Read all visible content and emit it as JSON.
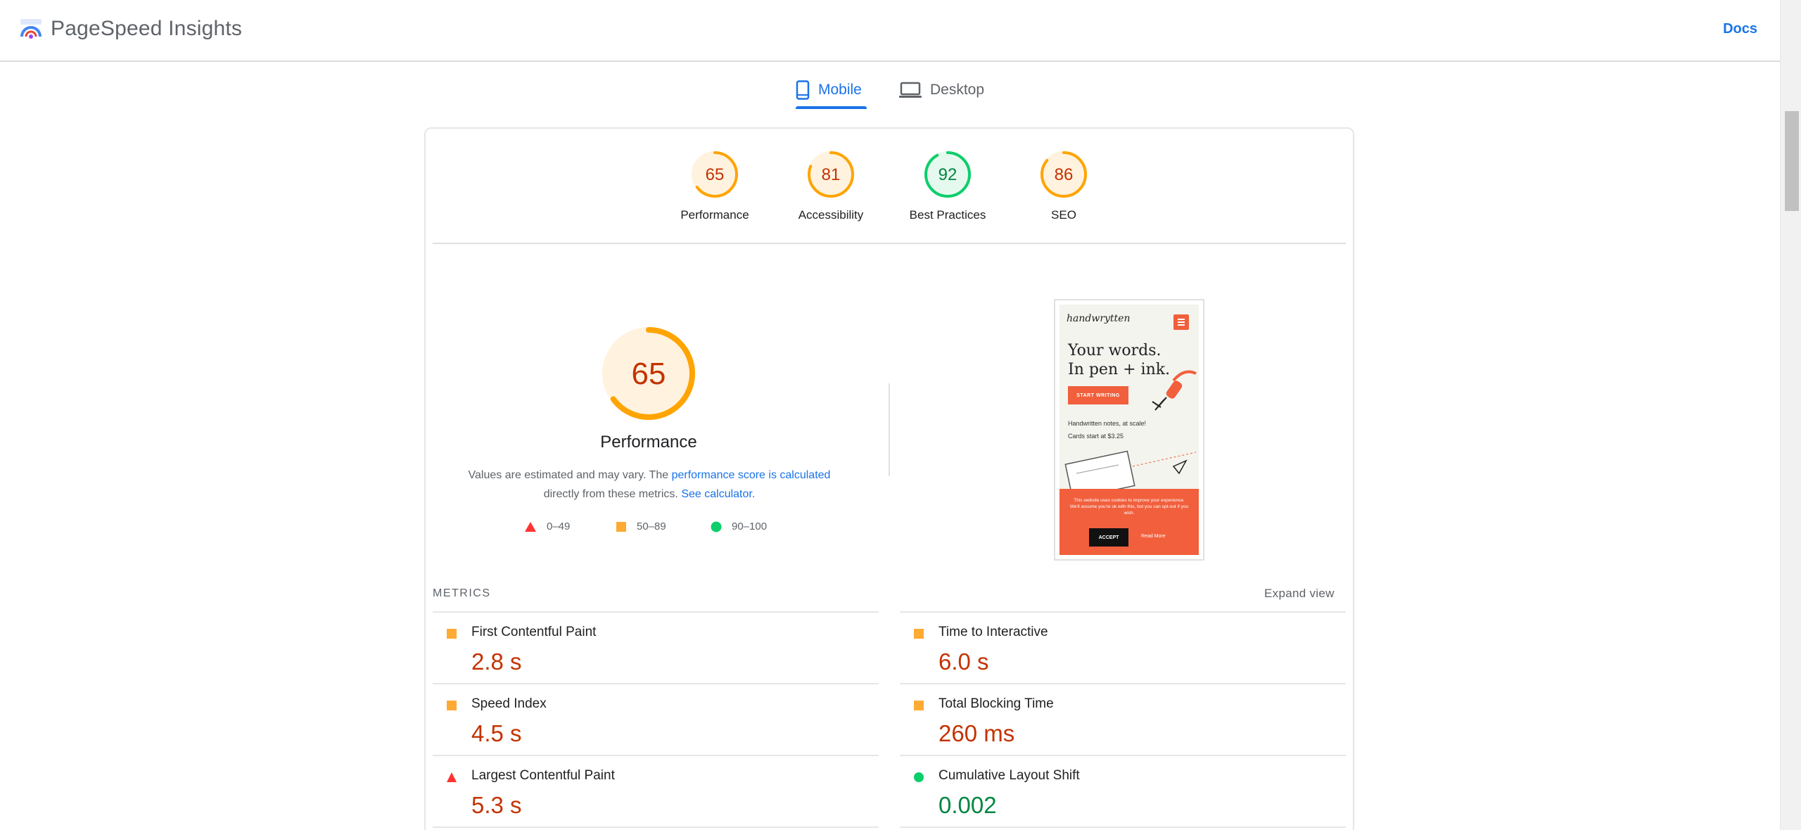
{
  "header": {
    "title": "PageSpeed Insights",
    "docs_label": "Docs"
  },
  "tabs": [
    {
      "label": "Mobile",
      "active": true,
      "icon": "phone-icon"
    },
    {
      "label": "Desktop",
      "active": false,
      "icon": "laptop-icon"
    }
  ],
  "gauges": [
    {
      "score": "65",
      "value": 65,
      "label": "Performance",
      "status": "average"
    },
    {
      "score": "81",
      "value": 81,
      "label": "Accessibility",
      "status": "average"
    },
    {
      "score": "92",
      "value": 92,
      "label": "Best Practices",
      "status": "pass"
    },
    {
      "score": "86",
      "value": 86,
      "label": "SEO",
      "status": "average"
    }
  ],
  "performance": {
    "score": "65",
    "value": 65,
    "title": "Performance",
    "note_prefix": "Values are estimated and may vary. The ",
    "note_link1": "performance score is calculated",
    "note_mid": "directly from these metrics. ",
    "note_link2": "See calculator.",
    "legend": [
      {
        "range": "0–49",
        "shape": "triangle",
        "color": "#ff3333"
      },
      {
        "range": "50–89",
        "shape": "square",
        "color": "#ffaa33"
      },
      {
        "range": "90–100",
        "shape": "circle",
        "color": "#0cce6b"
      }
    ]
  },
  "screenshot": {
    "brand": "handwrytten",
    "headline_line1": "Your words.",
    "headline_line2": "In pen + ink.",
    "cta": "START WRITING",
    "copy_line1": "Handwritten notes, at scale!",
    "copy_line2": "Cards start at $3.25",
    "cookie_text": "This website uses cookies to improve your experience. We'll assume you're ok with this, but you can opt-out if you wish.",
    "cookie_accept": "ACCEPT",
    "cookie_more": "Read More"
  },
  "metrics": {
    "heading": "METRICS",
    "expand_label": "Expand view",
    "items": [
      {
        "label": "First Contentful Paint",
        "value": "2.8 s",
        "status": "average"
      },
      {
        "label": "Time to Interactive",
        "value": "6.0 s",
        "status": "average"
      },
      {
        "label": "Speed Index",
        "value": "4.5 s",
        "status": "average"
      },
      {
        "label": "Total Blocking Time",
        "value": "260 ms",
        "status": "average"
      },
      {
        "label": "Largest Contentful Paint",
        "value": "5.3 s",
        "status": "fail"
      },
      {
        "label": "Cumulative Layout Shift",
        "value": "0.002",
        "status": "pass"
      }
    ]
  },
  "colors": {
    "accent": "#1a73e8",
    "average": "#ffa400",
    "average_fill": "#fff3e0",
    "average_text": "#c33300",
    "pass": "#0cce6b",
    "pass_fill": "#e6f9ef",
    "pass_text": "#018642",
    "fail": "#ff3333"
  }
}
